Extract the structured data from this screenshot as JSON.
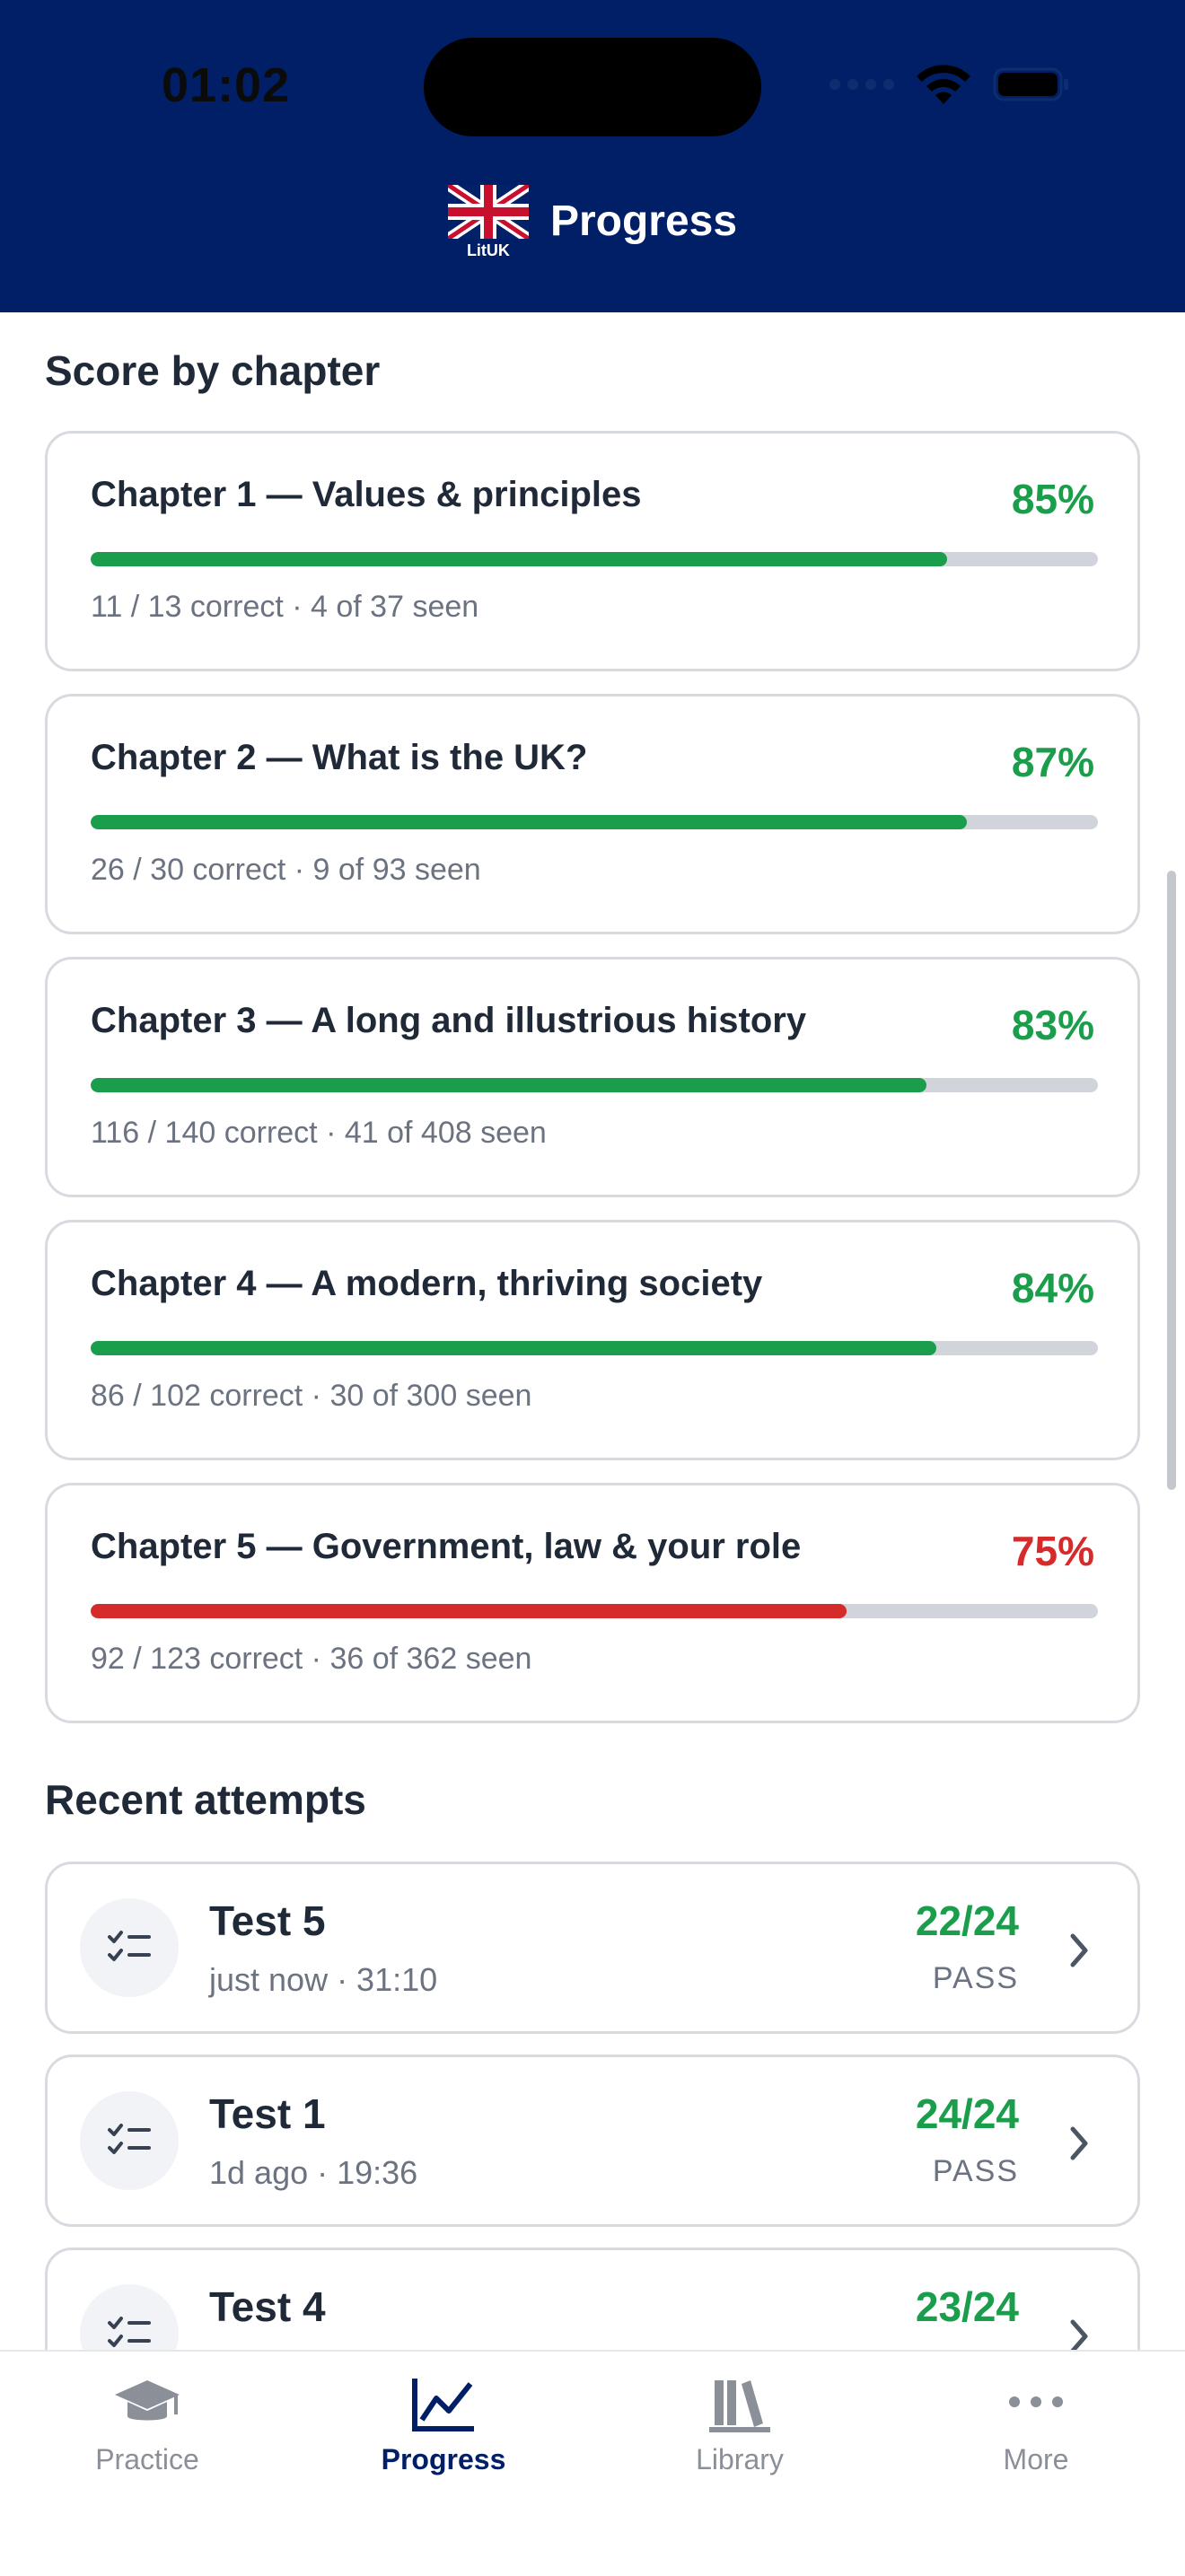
{
  "status_bar": {
    "time": "01:02"
  },
  "header": {
    "title": "Progress",
    "logo_text": "LitUK"
  },
  "chapters_section": {
    "title": "Score by chapter",
    "items": [
      {
        "title": "Chapter 1 — Values & principles",
        "percent": "85%",
        "progress": 0.85,
        "sub": "11 / 13 correct · 4 of 37 seen",
        "status_color": "#1a9e4b"
      },
      {
        "title": "Chapter 2 — What is the UK?",
        "percent": "87%",
        "progress": 0.87,
        "sub": "26 / 30 correct · 9 of 93 seen",
        "status_color": "#1a9e4b"
      },
      {
        "title": "Chapter 3 — A long and illustrious history",
        "percent": "83%",
        "progress": 0.83,
        "sub": "116 / 140 correct · 41 of 408 seen",
        "status_color": "#1a9e4b"
      },
      {
        "title": "Chapter 4 — A modern, thriving society",
        "percent": "84%",
        "progress": 0.84,
        "sub": "86 / 102 correct · 30 of 300 seen",
        "status_color": "#1a9e4b"
      },
      {
        "title": "Chapter 5 — Government, law & your role",
        "percent": "75%",
        "progress": 0.75,
        "sub": "92 / 123 correct · 36 of 362 seen",
        "status_color": "#d62b2b"
      }
    ]
  },
  "attempts_section": {
    "title": "Recent attempts",
    "items": [
      {
        "title": "Test 5",
        "sub": "just now · 31:10",
        "score": "22/24",
        "status": "PASS"
      },
      {
        "title": "Test 1",
        "sub": "1d ago · 19:36",
        "score": "24/24",
        "status": "PASS"
      },
      {
        "title": "Test 4",
        "sub": "",
        "score": "23/24",
        "status": ""
      }
    ]
  },
  "tabbar": {
    "tabs": [
      {
        "label": "Practice",
        "icon": "graduation-cap-icon",
        "active": false
      },
      {
        "label": "Progress",
        "icon": "line-chart-icon",
        "active": true
      },
      {
        "label": "Library",
        "icon": "books-icon",
        "active": false
      },
      {
        "label": "More",
        "icon": "more-dots-icon",
        "active": false
      }
    ]
  },
  "colors": {
    "header_bg": "#001f66",
    "pass_green": "#1a9e4b",
    "warn_red": "#d62b2b",
    "track_gray": "#d1d5db"
  }
}
